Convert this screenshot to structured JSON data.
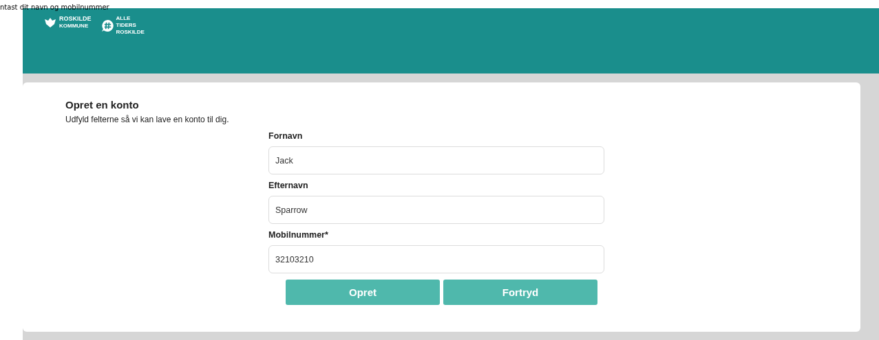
{
  "caption": "ntast dit navn og mobilnummer",
  "header": {
    "logos": [
      {
        "kind": "crest",
        "lines": [
          "ROSKILDE",
          "KOMMUNE"
        ]
      },
      {
        "kind": "hash",
        "lines": [
          "ALLE",
          "TIDERS",
          "ROSKILDE"
        ]
      }
    ]
  },
  "form": {
    "title": "Opret en konto",
    "subtitle": "Udfyld felterne så vi kan lave en konto til dig.",
    "fields": [
      {
        "label": "Fornavn",
        "value": "Jack"
      },
      {
        "label": "Efternavn",
        "value": "Sparrow"
      },
      {
        "label": "Mobilnummer*",
        "value": "32103210"
      }
    ],
    "buttons": [
      "Opret",
      "Fortryd"
    ]
  }
}
